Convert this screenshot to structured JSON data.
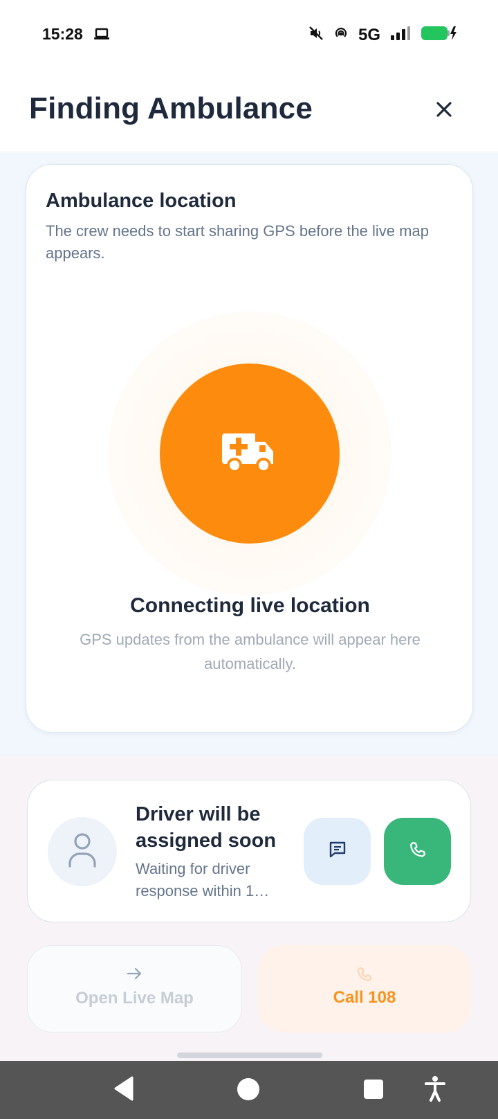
{
  "status_bar": {
    "time": "15:28",
    "network": "5G",
    "icons": [
      "laptop-icon",
      "mute-icon",
      "hotspot-icon",
      "signal-icon",
      "battery-charging-icon"
    ],
    "battery_color": "#22c55e"
  },
  "header": {
    "title": "Finding Ambulance",
    "close_icon": "close-icon"
  },
  "location_card": {
    "title": "Ambulance location",
    "subtitle": "The crew needs to start sharing GPS before the live map appears.",
    "icon": "ambulance-icon",
    "accent_color": "#fd8c0e",
    "status_title": "Connecting live location",
    "status_subtitle": "GPS updates from the ambulance will appear here automatically."
  },
  "driver_card": {
    "avatar_icon": "person-icon",
    "title": "Driver will be assigned soon",
    "subtitle": "Waiting for driver response within 1…",
    "message_icon": "message-icon",
    "call_icon": "phone-icon",
    "call_color": "#39b679"
  },
  "actions": {
    "live_map": {
      "label": "Open Live Map",
      "icon": "arrow-right-icon",
      "enabled": false
    },
    "call_108": {
      "label": "Call 108",
      "icon": "phone-icon"
    }
  },
  "nav_bar": {
    "icons": [
      "back-icon",
      "home-icon",
      "recents-icon",
      "accessibility-icon"
    ]
  }
}
